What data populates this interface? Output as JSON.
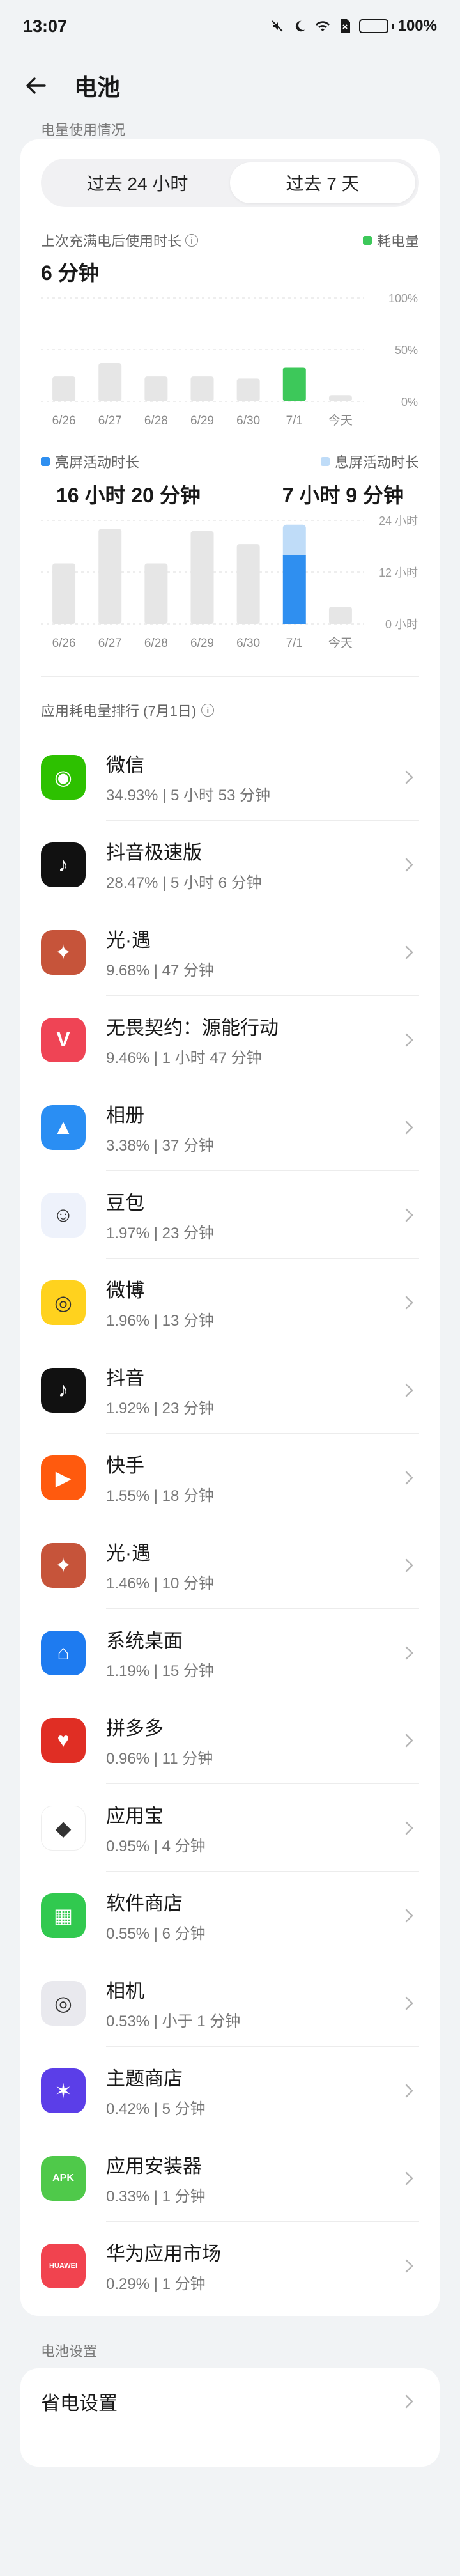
{
  "status": {
    "time": "13:07",
    "battery_percent": "100%",
    "battery_level": 1.0
  },
  "header": {
    "title": "电池"
  },
  "usage": {
    "section_label": "电量使用情况",
    "tabs": [
      {
        "label": "过去 24 小时",
        "active": false
      },
      {
        "label": "过去 7 天",
        "active": true
      }
    ],
    "since_charge_label": "上次充满电后使用时长",
    "since_charge_value": "6 分钟",
    "legend_power": "耗电量",
    "screen_on_label": "亮屏活动时长",
    "screen_on_value": "16 小时 20 分钟",
    "screen_off_label": "息屏活动时长",
    "screen_off_value": "7 小时 9 分钟"
  },
  "chart_data": [
    {
      "type": "bar",
      "categories": [
        "6/26",
        "6/27",
        "6/28",
        "6/29",
        "6/30",
        "7/1",
        "今天"
      ],
      "values": [
        24,
        37,
        24,
        24,
        22,
        33,
        6
      ],
      "highlight_index": 5,
      "ylim": [
        0,
        100
      ],
      "yticks": [
        "100%",
        "50%",
        "0%"
      ],
      "colors": {
        "normal": "#e6e6e6",
        "highlight": "#3dc85a"
      },
      "grid": true
    },
    {
      "type": "bar",
      "categories": [
        "6/26",
        "6/27",
        "6/28",
        "6/29",
        "6/30",
        "7/1",
        "今天"
      ],
      "series": [
        {
          "values": [
            14,
            22,
            14,
            21.5,
            18.5,
            16,
            4
          ]
        },
        {
          "values": [
            0,
            0,
            0,
            0,
            0,
            7,
            0
          ]
        }
      ],
      "highlight_index": 5,
      "ylim": [
        0,
        24
      ],
      "yticks": [
        "24 小时",
        "12 小时",
        "0 小时"
      ],
      "colors": {
        "normal": "#e6e6e6",
        "on": "#2f8ff0",
        "off": "#bfdcf8"
      },
      "grid": true
    }
  ],
  "ranking": {
    "title": "应用耗电量排行 (7月1日)",
    "apps": [
      {
        "name": "微信",
        "meta": "34.93% | 5 小时 53 分钟",
        "icon": "wechat-icon",
        "color": "#2dc100",
        "glyph": "◉"
      },
      {
        "name": "抖音极速版",
        "meta": "28.47% | 5 小时 6 分钟",
        "icon": "douyin-lite-icon",
        "color": "#111111",
        "glyph": "♪"
      },
      {
        "name": "光·遇",
        "meta": "9.68% | 47 分钟",
        "icon": "sky-game-icon",
        "color": "#c6543a",
        "glyph": "✦"
      },
      {
        "name": "无畏契约：源能行动",
        "meta": "9.46% | 1 小时 47 分钟",
        "icon": "valorant-icon",
        "color": "#ef4455",
        "glyph": "V"
      },
      {
        "name": "相册",
        "meta": "3.38% | 37 分钟",
        "icon": "gallery-icon",
        "color": "#2a8ef3",
        "glyph": "▲"
      },
      {
        "name": "豆包",
        "meta": "1.97% | 23 分钟",
        "icon": "doubao-icon",
        "color": "#eef2fb",
        "glyph": "☺"
      },
      {
        "name": "微博",
        "meta": "1.96% | 13 分钟",
        "icon": "weibo-icon",
        "color": "#ffd21e",
        "glyph": "◎"
      },
      {
        "name": "抖音",
        "meta": "1.92% | 23 分钟",
        "icon": "douyin-icon",
        "color": "#111111",
        "glyph": "♪"
      },
      {
        "name": "快手",
        "meta": "1.55% | 18 分钟",
        "icon": "kuaishou-icon",
        "color": "#ff5a0e",
        "glyph": "▶"
      },
      {
        "name": "光·遇",
        "meta": "1.46% | 10 分钟",
        "icon": "sky-game-icon-2",
        "color": "#c6543a",
        "glyph": "✦"
      },
      {
        "name": "系统桌面",
        "meta": "1.19% | 15 分钟",
        "icon": "home-icon",
        "color": "#1e7bf0",
        "glyph": "⌂"
      },
      {
        "name": "拼多多",
        "meta": "0.96% | 11 分钟",
        "icon": "pinduoduo-icon",
        "color": "#e02e24",
        "glyph": "♥"
      },
      {
        "name": "应用宝",
        "meta": "0.95% | 4 分钟",
        "icon": "yingyongbao-icon",
        "color": "#ffffff",
        "glyph": "◆"
      },
      {
        "name": "软件商店",
        "meta": "0.55% | 6 分钟",
        "icon": "app-store-icon",
        "color": "#31c94f",
        "glyph": "▦"
      },
      {
        "name": "相机",
        "meta": "0.53% | 小于 1 分钟",
        "icon": "camera-icon",
        "color": "#e9e9ee",
        "glyph": "◎"
      },
      {
        "name": "主题商店",
        "meta": "0.42% | 5 分钟",
        "icon": "theme-store-icon",
        "color": "#5b3ee8",
        "glyph": "✶"
      },
      {
        "name": "应用安装器",
        "meta": "0.33% | 1 分钟",
        "icon": "package-installer-icon",
        "color": "#4fc94a",
        "glyph": "APK"
      },
      {
        "name": "华为应用市场",
        "meta": "0.29% | 1 分钟",
        "icon": "huawei-appgallery-icon",
        "color": "#f1434f",
        "glyph": "HUAWEI"
      }
    ]
  },
  "settings": {
    "section_label": "电池设置",
    "items": [
      {
        "label": "省电设置"
      }
    ]
  }
}
